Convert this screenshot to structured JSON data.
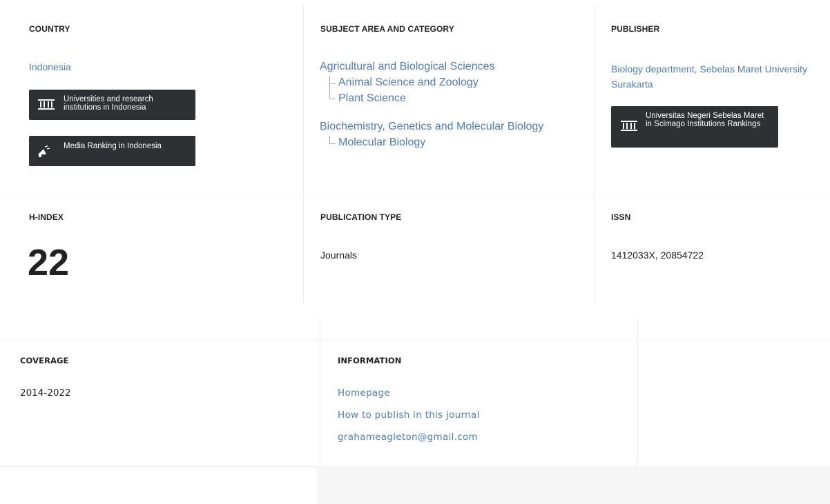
{
  "country": {
    "label": "COUNTRY",
    "value": "Indonesia",
    "buttons": {
      "universities": "Universities and research institutions in Indonesia",
      "media": "Media Ranking in Indonesia"
    }
  },
  "subject": {
    "label": "SUBJECT AREA AND CATEGORY",
    "areas": [
      {
        "name": "Agricultural and Biological Sciences",
        "categories": [
          "Animal Science and Zoology",
          "Plant Science"
        ]
      },
      {
        "name": "Biochemistry, Genetics and Molecular Biology",
        "categories": [
          "Molecular Biology"
        ]
      }
    ]
  },
  "publisher": {
    "label": "PUBLISHER",
    "value": "Biology department, Sebelas Maret University Surakarta",
    "button": "Universitas Negeri Sebelas Maret in Scimago Institutions Rankings"
  },
  "hindex": {
    "label": "H-INDEX",
    "value": "22"
  },
  "publication_type": {
    "label": "PUBLICATION TYPE",
    "value": "Journals"
  },
  "issn": {
    "label": "ISSN",
    "value": "1412033X, 20854722"
  },
  "coverage": {
    "label": "COVERAGE",
    "value": "2014-2022"
  },
  "information": {
    "label": "INFORMATION",
    "links": [
      "Homepage",
      "How to publish in this journal",
      "grahameagleton@gmail.com"
    ]
  },
  "icons": {
    "institution": "institution-icon",
    "megaphone": "megaphone-icon"
  },
  "colors": {
    "link": "#4f7dbd",
    "dark_button": "#2e3033",
    "divider": "#ececec"
  }
}
